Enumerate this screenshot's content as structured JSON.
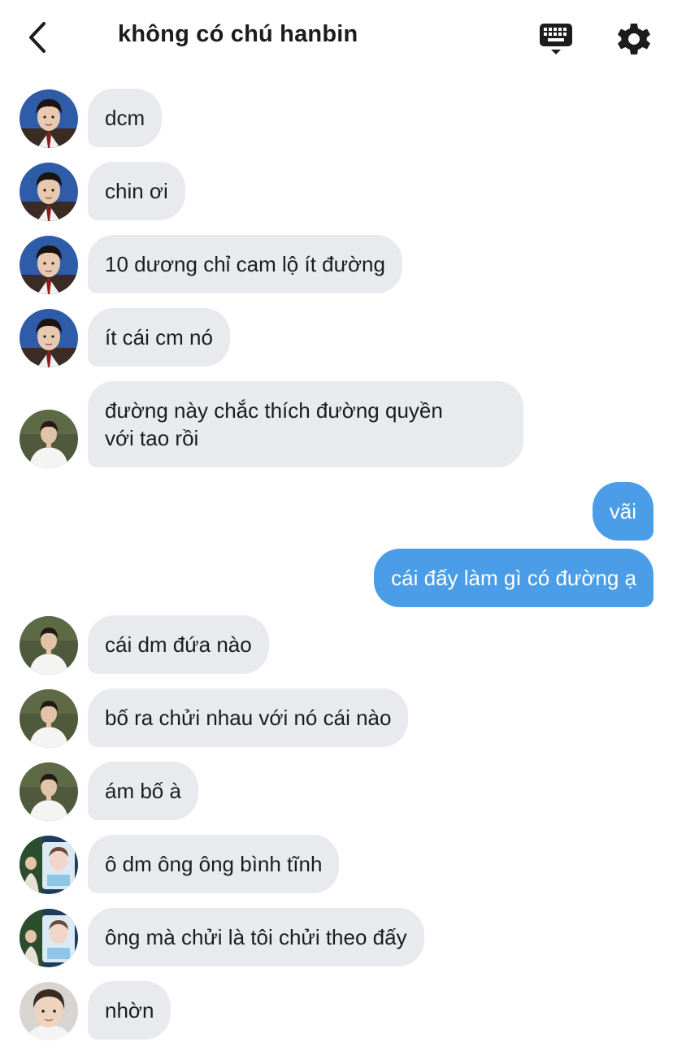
{
  "header": {
    "title": "không có chú hanbin",
    "back_icon": "chevron-left-icon",
    "keyboard_icon": "keyboard-icon",
    "settings_icon": "gear-icon"
  },
  "colors": {
    "incoming_bubble": "#e8eaee",
    "outgoing_bubble": "#4a9de6",
    "text": "#1c1c1e"
  },
  "messages": [
    {
      "direction": "in",
      "sender": "user-a",
      "text": "dcm"
    },
    {
      "direction": "in",
      "sender": "user-a",
      "text": "chin ơi"
    },
    {
      "direction": "in",
      "sender": "user-a",
      "text": "10 dương chỉ cam lộ ít đường"
    },
    {
      "direction": "in",
      "sender": "user-a",
      "text": "ít cái cm nó"
    },
    {
      "direction": "in",
      "sender": "user-b",
      "line1": "đường này chắc thích đường quyền",
      "line2": "với tao rồi"
    },
    {
      "direction": "out",
      "text": "vãi"
    },
    {
      "direction": "out",
      "text": "cái đấy làm gì có đường ạ"
    },
    {
      "direction": "in",
      "sender": "user-b",
      "text": "cái dm đứa nào"
    },
    {
      "direction": "in",
      "sender": "user-b",
      "text": "bố ra chửi nhau với nó cái nào"
    },
    {
      "direction": "in",
      "sender": "user-b",
      "text": "ám bố à"
    },
    {
      "direction": "in",
      "sender": "user-c",
      "text": "ô dm ông ông bình tĩnh"
    },
    {
      "direction": "in",
      "sender": "user-c",
      "text": "ông mà chửi là tôi chửi theo đấy"
    },
    {
      "direction": "in",
      "sender": "user-d",
      "text": "nhờn"
    }
  ]
}
